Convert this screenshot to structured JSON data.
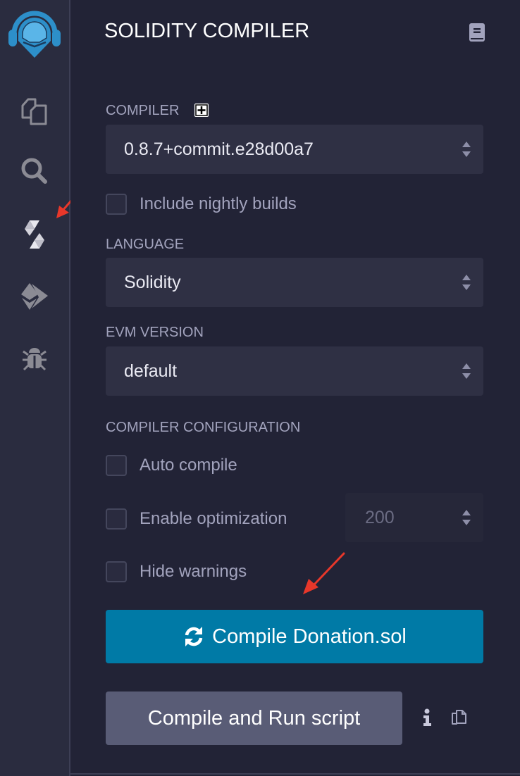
{
  "iconbar": {
    "items": [
      {
        "name": "remix-logo",
        "icon": "remix-logo-icon"
      },
      {
        "name": "file-explorer",
        "icon": "files-icon"
      },
      {
        "name": "search",
        "icon": "search-icon"
      },
      {
        "name": "solidity-compiler",
        "icon": "solidity-icon",
        "active": true
      },
      {
        "name": "deploy-run",
        "icon": "ethereum-icon"
      },
      {
        "name": "debugger",
        "icon": "bug-icon"
      }
    ]
  },
  "panel": {
    "title": "SOLIDITY COMPILER",
    "docs_icon": "book-icon",
    "compiler": {
      "label": "COMPILER",
      "add_icon": "plus-square-icon",
      "selected_version": "0.8.7+commit.e28d00a7"
    },
    "nightly": {
      "label": "Include nightly builds",
      "checked": false
    },
    "language": {
      "label": "LANGUAGE",
      "selected": "Solidity"
    },
    "evm": {
      "label": "EVM VERSION",
      "selected": "default"
    },
    "config": {
      "label": "COMPILER CONFIGURATION",
      "auto_compile": {
        "label": "Auto compile",
        "checked": false
      },
      "optimization": {
        "label": "Enable optimization",
        "checked": false,
        "runs": "200"
      },
      "hide_warnings": {
        "label": "Hide warnings",
        "checked": false
      }
    },
    "compile_button": {
      "label": "Compile Donation.sol",
      "icon": "refresh-icon"
    },
    "run_button": {
      "label": "Compile and Run script"
    },
    "info_icon": "info-icon",
    "copy_icon": "copy-icon"
  },
  "colors": {
    "background": "#222336",
    "iconbar": "#2a2c3f",
    "accent": "#007aa6",
    "secondary_button": "#595c76",
    "annotation_arrow": "#e8372a"
  }
}
